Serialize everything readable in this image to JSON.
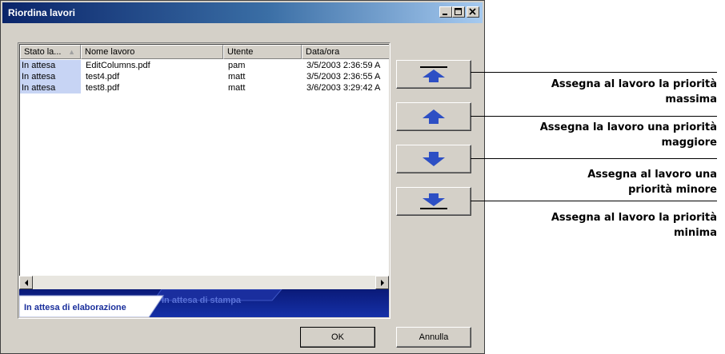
{
  "window": {
    "title": "Riordina lavori"
  },
  "list": {
    "columns": [
      "Stato la...",
      "Nome lavoro",
      "Utente",
      "Data/ora"
    ],
    "rows": [
      [
        "In attesa",
        "EditColumns.pdf",
        "pam",
        "3/5/2003 2:36:59 A"
      ],
      [
        "In attesa",
        "test4.pdf",
        "matt",
        "3/5/2003 2:36:55 A"
      ],
      [
        "In attesa",
        "test8.pdf",
        "matt",
        "3/6/2003 3:29:42 A"
      ]
    ]
  },
  "tabs": {
    "active": "In attesa di elaborazione",
    "inactive": "In attesa di stampa"
  },
  "buttons": {
    "ok": "OK",
    "cancel": "Annulla"
  },
  "priority_buttons": {
    "top": "arrow-to-top-icon",
    "up": "arrow-up-icon",
    "down": "arrow-down-icon",
    "bottom": "arrow-to-bottom-icon"
  },
  "callouts": {
    "top": [
      "Assegna al lavoro la priorità",
      "massima"
    ],
    "up": [
      "Assegna la lavoro una priorità",
      "maggiore"
    ],
    "down": [
      "Assegna al lavoro una",
      "priorità minore"
    ],
    "bottom": [
      "Assegna al lavoro la priorità",
      "minima"
    ]
  },
  "colors": {
    "arrow": "#2d4fc4",
    "tab_bar": "#0f1f8c",
    "status_highlight": "#c7d4f4"
  }
}
